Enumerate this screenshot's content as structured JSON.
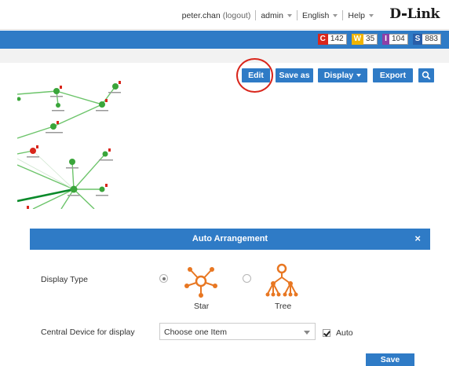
{
  "header": {
    "user": "peter.chan",
    "logout": "(logout)",
    "role": "admin",
    "language": "English",
    "help": "Help",
    "logo": "D-Link"
  },
  "alarms": [
    {
      "key": "C",
      "value": "142",
      "color": "#d9261c"
    },
    {
      "key": "W",
      "value": "35",
      "color": "#f0b400"
    },
    {
      "key": "I",
      "value": "104",
      "color": "#8e3fa6"
    },
    {
      "key": "S",
      "value": "883",
      "color": "#2a5ea8"
    }
  ],
  "toolbar": {
    "edit": "Edit",
    "save_as": "Save as",
    "display": "Display",
    "export": "Export",
    "search_icon": "search-icon"
  },
  "dialog": {
    "title": "Auto Arrangement",
    "close": "×",
    "display_type_label": "Display Type",
    "star_label": "Star",
    "tree_label": "Tree",
    "selected_type": "Star",
    "central_label": "Central Device for display",
    "central_value": "Choose one Item",
    "auto_label": "Auto",
    "auto_checked": true,
    "save": "Save"
  }
}
